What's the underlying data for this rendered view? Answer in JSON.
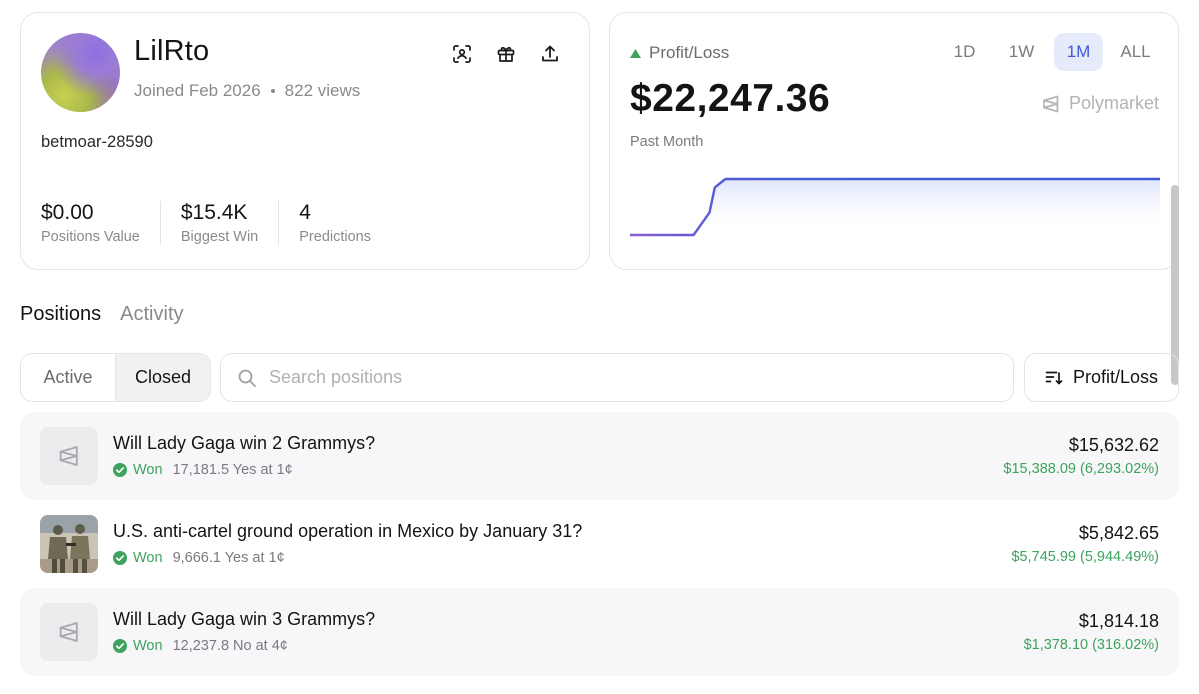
{
  "profile": {
    "username": "LilRto",
    "joined": "Joined Feb 2026",
    "views": "822 views",
    "handle": "betmoar-28590",
    "stats": [
      {
        "value": "$0.00",
        "label": "Positions Value"
      },
      {
        "value": "$15.4K",
        "label": "Biggest Win"
      },
      {
        "value": "4",
        "label": "Predictions"
      }
    ],
    "actions": [
      "scan-icon",
      "gift-icon",
      "share-icon"
    ]
  },
  "pnl": {
    "label": "Profit/Loss",
    "value": "$22,247.36",
    "period": "Past Month",
    "ranges": [
      "1D",
      "1W",
      "1M",
      "ALL"
    ],
    "active_range": "1M",
    "brand": "Polymarket",
    "colors": {
      "line_start": "#8a5fd0",
      "line_end": "#3d5bd9",
      "fill": "#e6ebfb",
      "up": "#3da35d"
    }
  },
  "chart_data": {
    "type": "line",
    "x": [
      0,
      0.12,
      0.15,
      0.16,
      0.18,
      0.25,
      0.5,
      0.75,
      1.0
    ],
    "values": [
      0,
      0,
      0.4,
      0.85,
      1,
      1,
      1,
      1,
      1
    ],
    "ylim": [
      0,
      1
    ],
    "grid": false
  },
  "tabs": {
    "items": [
      "Positions",
      "Activity"
    ],
    "active": "Positions"
  },
  "filters": {
    "segments": [
      "Active",
      "Closed"
    ],
    "active_segment": "Closed",
    "search_placeholder": "Search positions",
    "sort_label": "Profit/Loss"
  },
  "positions": [
    {
      "title": "Will Lady Gaga win 2 Grammys?",
      "status": "Won",
      "shares": "17,181.5 Yes at 1¢",
      "value": "$15,632.62",
      "gain": "$15,388.09 (6,293.02%)",
      "thumb": "polymarket-icon"
    },
    {
      "title": "U.S. anti-cartel ground operation in Mexico by January 31?",
      "status": "Won",
      "shares": "9,666.1 Yes at 1¢",
      "value": "$5,842.65",
      "gain": "$5,745.99 (5,944.49%)",
      "thumb": "soldiers-photo"
    },
    {
      "title": "Will Lady Gaga win 3 Grammys?",
      "status": "Won",
      "shares": "12,237.8 No at 4¢",
      "value": "$1,814.18",
      "gain": "$1,378.10 (316.02%)",
      "thumb": "polymarket-icon"
    }
  ]
}
